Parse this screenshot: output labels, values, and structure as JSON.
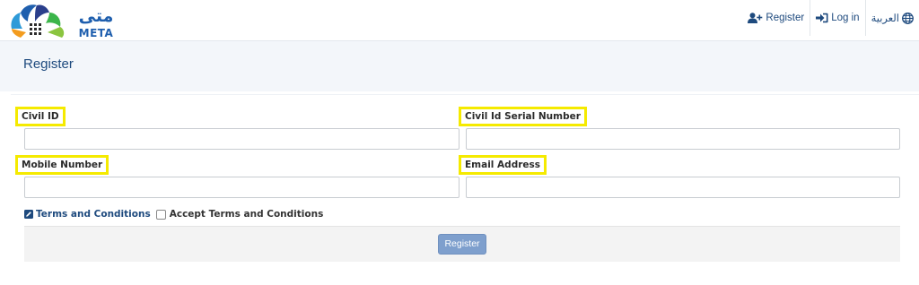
{
  "brand": {
    "logo_text_arabic": "متى",
    "logo_text_latin": "META"
  },
  "nav": {
    "register_label": "Register",
    "login_label": "Log in",
    "language_label": "العربية"
  },
  "page": {
    "title": "Register"
  },
  "form": {
    "civil_id": {
      "label": "Civil ID",
      "value": "",
      "placeholder": ""
    },
    "civil_id_serial": {
      "label": "Civil Id Serial Number",
      "value": "",
      "placeholder": ""
    },
    "mobile_number": {
      "label": "Mobile Number",
      "value": "",
      "placeholder": ""
    },
    "email_address": {
      "label": "Email Address",
      "value": "",
      "placeholder": ""
    },
    "terms_link_label": "Terms and Conditions",
    "accept_terms_label": "Accept Terms and Conditions",
    "accept_terms_checked": false,
    "submit_label": "Register"
  },
  "icons": {
    "register": "user-plus-icon",
    "login": "sign-in-icon",
    "language": "globe-icon",
    "terms": "edit-icon"
  },
  "colors": {
    "primary": "#1e4a7e",
    "highlight": "#f5ea00",
    "button": "#7e9fcd",
    "band": "#f3f6fa"
  }
}
